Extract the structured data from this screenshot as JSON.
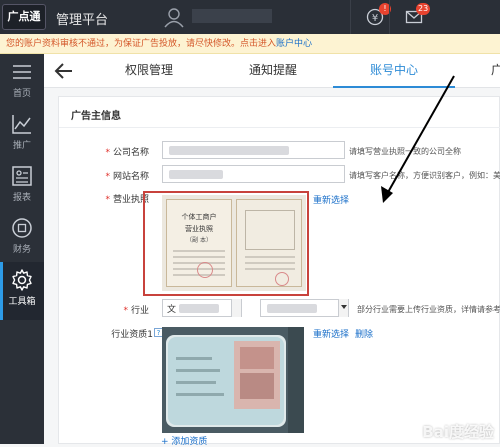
{
  "app": {
    "logo_text": "广点通",
    "title": "管理平台"
  },
  "header": {
    "coin_badge": "!",
    "mail_badge": "23"
  },
  "notice": {
    "text": "您的账户资料审核不通过，为保证广告投放，请尽快修改。点击进入",
    "link": "账户中心"
  },
  "sidebar": {
    "items": [
      {
        "label": "首页",
        "icon": "menu-icon"
      },
      {
        "label": "推广",
        "icon": "trend-icon"
      },
      {
        "label": "报表",
        "icon": "report-icon"
      },
      {
        "label": "财务",
        "icon": "finance-icon"
      },
      {
        "label": "工具箱",
        "icon": "gear-icon"
      }
    ]
  },
  "tabs": [
    {
      "label": "权限管理"
    },
    {
      "label": "通知提醒"
    },
    {
      "label": "账号中心"
    },
    {
      "label": "广"
    }
  ],
  "form": {
    "section_title": "广告主信息",
    "company_label": "公司名称",
    "company_hint": "请填写营业执照一致的公司全称",
    "website_label": "网站名称",
    "website_hint": "请填写客户名称，方便识别客户，例如：美丽",
    "license_label": "营业执照",
    "license_reselect": "重新选择",
    "license_title": "个体工商户",
    "license_title2": "营业执照",
    "license_sub": "（副 本）",
    "industry_label": "行业",
    "industry_value": "文",
    "industry_hint": "部分行业需要上传行业资质，详情请参考",
    "qualification_label": "行业资质1",
    "qualification_help": "?",
    "qual_reselect": "重新选择",
    "qual_delete": "删除",
    "add_qualification": "+ 添加资质"
  },
  "watermark": "Bai度经验",
  "colors": {
    "accent": "#2d8bd6",
    "highlight_border": "#c8423c",
    "topbar": "#2a2f37",
    "sidebar": "#2b3038"
  }
}
